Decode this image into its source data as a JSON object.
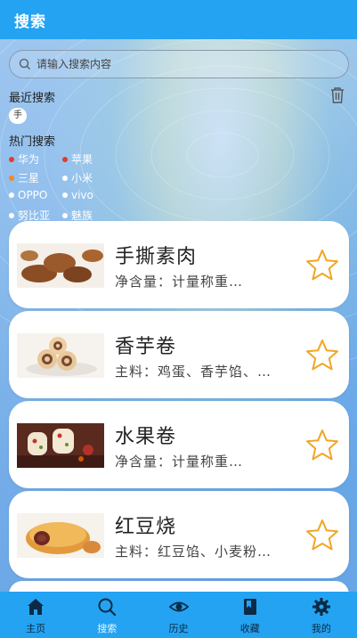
{
  "header": {
    "title": "搜索"
  },
  "search": {
    "placeholder": "请输入搜索内容"
  },
  "recent": {
    "label": "最近搜索",
    "items": [
      "手"
    ]
  },
  "hot": {
    "label": "热门搜索",
    "items": [
      {
        "label": "华为",
        "dot_color": "#e23b2c"
      },
      {
        "label": "苹果",
        "dot_color": "#e23b2c"
      },
      {
        "label": "三星",
        "dot_color": "#f08a24"
      },
      {
        "label": "小米",
        "dot_color": "#ffffff"
      },
      {
        "label": "OPPO",
        "dot_color": "#ffffff"
      },
      {
        "label": "vivo",
        "dot_color": "#ffffff"
      },
      {
        "label": "努比亚",
        "dot_color": "#ffffff"
      },
      {
        "label": "魅族",
        "dot_color": "#ffffff"
      }
    ]
  },
  "products": [
    {
      "title": "手撕素肉",
      "subtitle": "净含量：计量称重…",
      "icon": "star-icon"
    },
    {
      "title": "香芋卷",
      "subtitle": "主料：鸡蛋、香芋馅、…",
      "icon": "star-icon"
    },
    {
      "title": "水果卷",
      "subtitle": "净含量：计量称重…",
      "icon": "star-icon"
    },
    {
      "title": "红豆烧",
      "subtitle": "主料：红豆馅、小麦粉…",
      "icon": "star-icon"
    }
  ],
  "tabs": [
    {
      "label": "主页",
      "icon": "home-icon"
    },
    {
      "label": "搜索",
      "icon": "search-icon"
    },
    {
      "label": "历史",
      "icon": "eye-icon"
    },
    {
      "label": "收藏",
      "icon": "book-icon"
    },
    {
      "label": "我的",
      "icon": "gear-icon"
    }
  ],
  "colors": {
    "accent": "#24a3f2",
    "star": "#f2a623",
    "active_tab_text": "#e8f4ff"
  }
}
